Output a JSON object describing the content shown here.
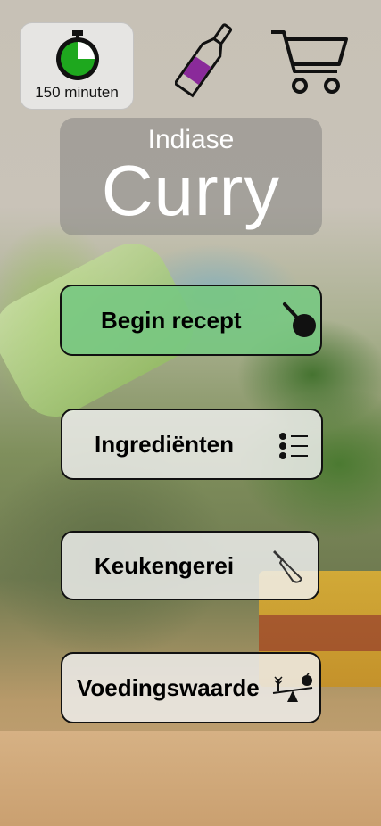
{
  "timer": {
    "label": "150 minuten",
    "icon": "stopwatch-icon",
    "elapsed_fraction": 0.25
  },
  "header_icons": {
    "drink": "wine-bottle-icon",
    "shop": "shopping-cart-icon"
  },
  "title": {
    "subtitle": "Indiase",
    "main": "Curry"
  },
  "buttons": {
    "start": {
      "label": "Begin recept",
      "icon": "frying-pan-icon"
    },
    "ingredients": {
      "label": "Ingrediënten",
      "icon": "list-icon"
    },
    "tools": {
      "label": "Keukengerei",
      "icon": "knife-icon"
    },
    "nutrition": {
      "label": "Voedingswaarde",
      "icon": "balance-scale-icon"
    }
  },
  "colors": {
    "start_button": "#78c882",
    "timer_green": "#1ea81e"
  }
}
